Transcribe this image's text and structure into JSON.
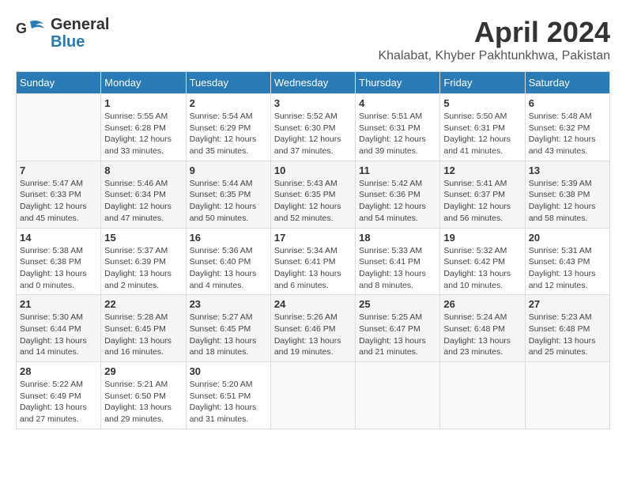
{
  "header": {
    "logo_general": "General",
    "logo_blue": "Blue",
    "month": "April 2024",
    "location": "Khalabat, Khyber Pakhtunkhwa, Pakistan"
  },
  "weekdays": [
    "Sunday",
    "Monday",
    "Tuesday",
    "Wednesday",
    "Thursday",
    "Friday",
    "Saturday"
  ],
  "weeks": [
    [
      {
        "day": "",
        "info": ""
      },
      {
        "day": "1",
        "info": "Sunrise: 5:55 AM\nSunset: 6:28 PM\nDaylight: 12 hours\nand 33 minutes."
      },
      {
        "day": "2",
        "info": "Sunrise: 5:54 AM\nSunset: 6:29 PM\nDaylight: 12 hours\nand 35 minutes."
      },
      {
        "day": "3",
        "info": "Sunrise: 5:52 AM\nSunset: 6:30 PM\nDaylight: 12 hours\nand 37 minutes."
      },
      {
        "day": "4",
        "info": "Sunrise: 5:51 AM\nSunset: 6:31 PM\nDaylight: 12 hours\nand 39 minutes."
      },
      {
        "day": "5",
        "info": "Sunrise: 5:50 AM\nSunset: 6:31 PM\nDaylight: 12 hours\nand 41 minutes."
      },
      {
        "day": "6",
        "info": "Sunrise: 5:48 AM\nSunset: 6:32 PM\nDaylight: 12 hours\nand 43 minutes."
      }
    ],
    [
      {
        "day": "7",
        "info": "Sunrise: 5:47 AM\nSunset: 6:33 PM\nDaylight: 12 hours\nand 45 minutes."
      },
      {
        "day": "8",
        "info": "Sunrise: 5:46 AM\nSunset: 6:34 PM\nDaylight: 12 hours\nand 47 minutes."
      },
      {
        "day": "9",
        "info": "Sunrise: 5:44 AM\nSunset: 6:35 PM\nDaylight: 12 hours\nand 50 minutes."
      },
      {
        "day": "10",
        "info": "Sunrise: 5:43 AM\nSunset: 6:35 PM\nDaylight: 12 hours\nand 52 minutes."
      },
      {
        "day": "11",
        "info": "Sunrise: 5:42 AM\nSunset: 6:36 PM\nDaylight: 12 hours\nand 54 minutes."
      },
      {
        "day": "12",
        "info": "Sunrise: 5:41 AM\nSunset: 6:37 PM\nDaylight: 12 hours\nand 56 minutes."
      },
      {
        "day": "13",
        "info": "Sunrise: 5:39 AM\nSunset: 6:38 PM\nDaylight: 12 hours\nand 58 minutes."
      }
    ],
    [
      {
        "day": "14",
        "info": "Sunrise: 5:38 AM\nSunset: 6:38 PM\nDaylight: 13 hours\nand 0 minutes."
      },
      {
        "day": "15",
        "info": "Sunrise: 5:37 AM\nSunset: 6:39 PM\nDaylight: 13 hours\nand 2 minutes."
      },
      {
        "day": "16",
        "info": "Sunrise: 5:36 AM\nSunset: 6:40 PM\nDaylight: 13 hours\nand 4 minutes."
      },
      {
        "day": "17",
        "info": "Sunrise: 5:34 AM\nSunset: 6:41 PM\nDaylight: 13 hours\nand 6 minutes."
      },
      {
        "day": "18",
        "info": "Sunrise: 5:33 AM\nSunset: 6:41 PM\nDaylight: 13 hours\nand 8 minutes."
      },
      {
        "day": "19",
        "info": "Sunrise: 5:32 AM\nSunset: 6:42 PM\nDaylight: 13 hours\nand 10 minutes."
      },
      {
        "day": "20",
        "info": "Sunrise: 5:31 AM\nSunset: 6:43 PM\nDaylight: 13 hours\nand 12 minutes."
      }
    ],
    [
      {
        "day": "21",
        "info": "Sunrise: 5:30 AM\nSunset: 6:44 PM\nDaylight: 13 hours\nand 14 minutes."
      },
      {
        "day": "22",
        "info": "Sunrise: 5:28 AM\nSunset: 6:45 PM\nDaylight: 13 hours\nand 16 minutes."
      },
      {
        "day": "23",
        "info": "Sunrise: 5:27 AM\nSunset: 6:45 PM\nDaylight: 13 hours\nand 18 minutes."
      },
      {
        "day": "24",
        "info": "Sunrise: 5:26 AM\nSunset: 6:46 PM\nDaylight: 13 hours\nand 19 minutes."
      },
      {
        "day": "25",
        "info": "Sunrise: 5:25 AM\nSunset: 6:47 PM\nDaylight: 13 hours\nand 21 minutes."
      },
      {
        "day": "26",
        "info": "Sunrise: 5:24 AM\nSunset: 6:48 PM\nDaylight: 13 hours\nand 23 minutes."
      },
      {
        "day": "27",
        "info": "Sunrise: 5:23 AM\nSunset: 6:48 PM\nDaylight: 13 hours\nand 25 minutes."
      }
    ],
    [
      {
        "day": "28",
        "info": "Sunrise: 5:22 AM\nSunset: 6:49 PM\nDaylight: 13 hours\nand 27 minutes."
      },
      {
        "day": "29",
        "info": "Sunrise: 5:21 AM\nSunset: 6:50 PM\nDaylight: 13 hours\nand 29 minutes."
      },
      {
        "day": "30",
        "info": "Sunrise: 5:20 AM\nSunset: 6:51 PM\nDaylight: 13 hours\nand 31 minutes."
      },
      {
        "day": "",
        "info": ""
      },
      {
        "day": "",
        "info": ""
      },
      {
        "day": "",
        "info": ""
      },
      {
        "day": "",
        "info": ""
      }
    ]
  ]
}
